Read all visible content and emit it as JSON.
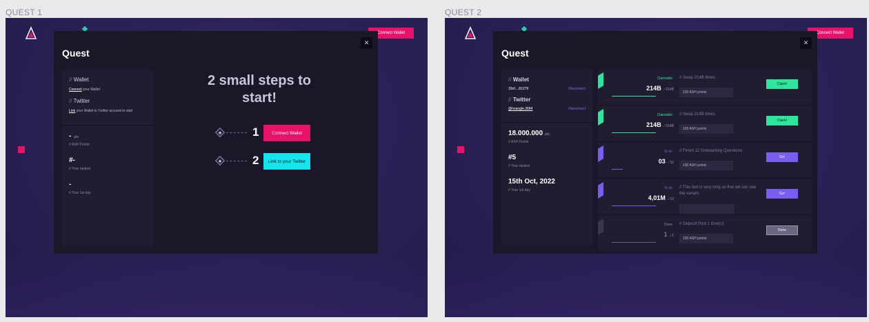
{
  "frames": [
    {
      "label": "QUEST 1",
      "top_button": "Connect Wallet",
      "modal": {
        "title": "Quest",
        "close": "✕",
        "wallet_title_prefix": "//",
        "wallet_title": "Wallet",
        "wallet_link": "Connect",
        "wallet_text": " your Wallet",
        "twitter_title_prefix": "//",
        "twitter_title": "Twitter",
        "twitter_link": "Link",
        "twitter_text": " your Wallet to Twitter account to start",
        "stats": [
          {
            "value": "-",
            "unit": "pts",
            "sub": "// ASH Points"
          },
          {
            "value": "#-",
            "unit": "",
            "sub": "// Your ranked"
          },
          {
            "value": "-",
            "unit": "",
            "sub": "// Your 1st day"
          }
        ],
        "steps_heading": "2 small steps to start!",
        "steps": [
          {
            "num": "1",
            "label": "Connect Wallet"
          },
          {
            "num": "2",
            "label": "Link to your Twitter"
          }
        ]
      }
    },
    {
      "label": "QUEST 2",
      "top_button": "Connect Wallet",
      "modal": {
        "title": "Quest",
        "close": "✕",
        "wallet_title_prefix": "//",
        "wallet_title": "Wallet",
        "wallet_address": "33nf....81279",
        "disconnect": "Disconnect",
        "twitter_title_prefix": "//",
        "twitter_title": "Twitter",
        "twitter_handle": "@hoangle.3684",
        "stats": [
          {
            "value": "18.000.000",
            "unit": "pts",
            "sub": "// ASH Points"
          },
          {
            "value": "#5",
            "unit": "",
            "sub": "// Your ranked"
          },
          {
            "value": "15th Oct, 2022",
            "unit": "",
            "sub": "// Your 1st day"
          }
        ],
        "tasks": [
          {
            "status": "Claimable",
            "value": "214B",
            "total": "214B",
            "name": "Swap 214B times",
            "points": "100 ASH points",
            "action": "Claim!",
            "kind": "claim",
            "progress": 1.0
          },
          {
            "status": "Claimable",
            "value": "214B",
            "total": "214B",
            "name": "Swap 214B times",
            "points": "100 ASH points",
            "action": "Claim!",
            "kind": "claim",
            "progress": 1.0
          },
          {
            "status": "To do",
            "value": "03",
            "total": "12",
            "name": "Finish 12 Onboarding Questions",
            "points": "100 ASH points",
            "action": "Go!",
            "kind": "go",
            "progress": 0.25
          },
          {
            "status": "To do",
            "value": "4,01M",
            "total": "12",
            "name": "This text is very long so that we can see the variant.",
            "points": "",
            "action": "Go!",
            "kind": "go",
            "progress": 1.0
          },
          {
            "status": "Done",
            "value": "1",
            "total": "1",
            "name": "Deposit Pool 1 time(s)",
            "points": "100 ASH points",
            "action": "Done",
            "kind": "done",
            "progress": 1.0
          }
        ]
      }
    }
  ],
  "colors": {
    "pink": "#e8126a",
    "cyan": "#15e6ee",
    "green": "#2ee59d",
    "purple": "#7b5cf0",
    "panel": "#1a1728"
  }
}
